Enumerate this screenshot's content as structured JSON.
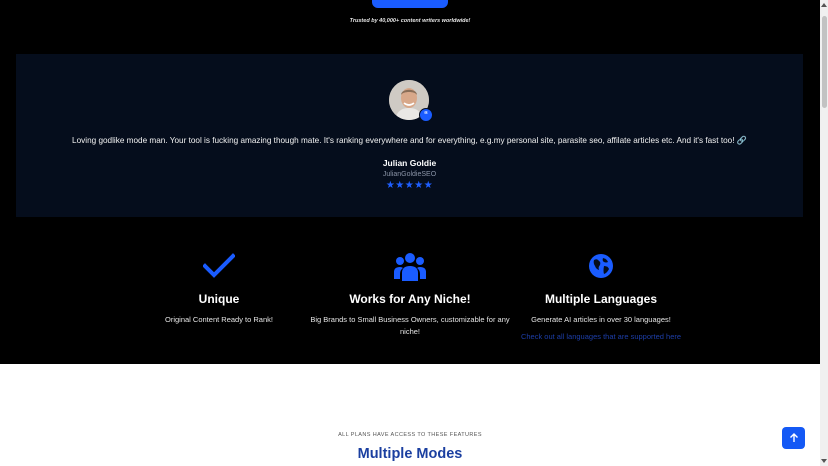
{
  "hero": {
    "trusted_text": "Trusted by 40,000+ content writers worldwide!"
  },
  "testimonial": {
    "quote_badge": "“",
    "quote": "Loving godlike mode man. Your tool is fucking amazing though mate. It's ranking everywhere and for everything, e.g.my personal site, parasite seo, affilate articles etc. And it's fast too! 🔗",
    "author": "Julian Goldie",
    "handle": "JulianGoldieSEO",
    "stars": "★★★★★",
    "rating": 5
  },
  "features": [
    {
      "title": "Unique",
      "description": "Original Content Ready to Rank!",
      "icon": "checkmark-icon"
    },
    {
      "title": "Works for Any Niche!",
      "description": "Big Brands to Small Business Owners, customizable for any niche!",
      "icon": "users-group-icon"
    },
    {
      "title": "Multiple Languages",
      "description": "Generate AI articles in over 30 languages!",
      "link": "Check out all languages that are supported here",
      "icon": "globe-icon"
    }
  ],
  "plans": {
    "eyebrow": "ALL PLANS HAVE ACCESS TO THESE FEATURES",
    "title": "Multiple Modes"
  },
  "colors": {
    "accent": "#1a5cff",
    "panel": "#050d1c",
    "title_blue": "#1b3fa0",
    "background": "#000000"
  }
}
